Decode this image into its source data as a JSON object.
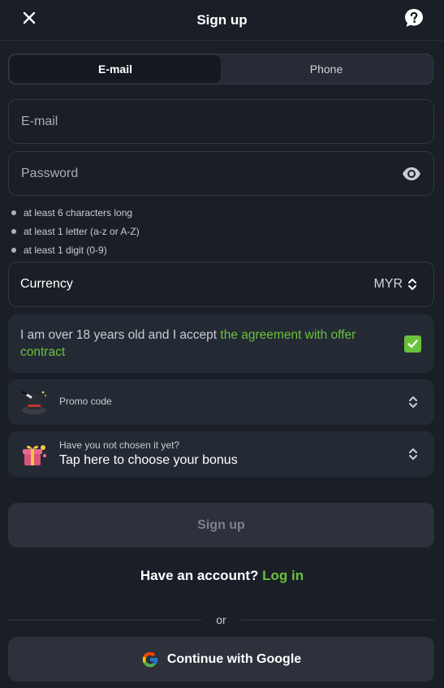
{
  "header": {
    "title": "Sign up",
    "close_icon": "close-icon",
    "help_icon": "help-chat-icon"
  },
  "tabs": [
    {
      "label": "E-mail",
      "active": true
    },
    {
      "label": "Phone",
      "active": false
    }
  ],
  "email_field": {
    "placeholder": "E-mail",
    "value": ""
  },
  "password_field": {
    "placeholder": "Password",
    "value": "",
    "toggle_icon": "eye-icon"
  },
  "password_rules": [
    "at least 6 characters long",
    "at least 1 letter (a-z or A-Z)",
    "at least 1 digit (0-9)"
  ],
  "currency": {
    "label": "Currency",
    "value": "MYR"
  },
  "agreement": {
    "text": "I am over 18 years old and I accept ",
    "link": "the agreement with offer contract",
    "checked": true
  },
  "promo": {
    "label": "Promo code",
    "icon": "magic-hat-icon"
  },
  "bonus": {
    "subtitle": "Have you not chosen it yet?",
    "title": "Tap here to choose your bonus",
    "icon": "gift-box-icon"
  },
  "signup_button": "Sign up",
  "account": {
    "text": "Have an account?",
    "login": "Log in"
  },
  "divider": "or",
  "google_button": "Continue with Google",
  "colors": {
    "background": "#1a1e26",
    "card": "#242a34",
    "accent_green": "#6ac23c",
    "button_disabled": "#2c313b"
  }
}
